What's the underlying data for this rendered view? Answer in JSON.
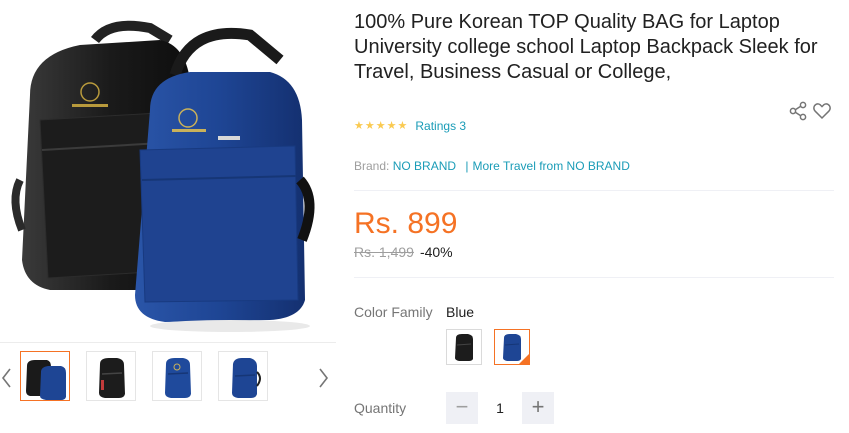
{
  "product": {
    "title": "100% Pure Korean TOP Quality BAG for Laptop University college school Laptop Backpack Sleek for Travel, Business Casual or College,",
    "rating_stars": 5,
    "ratings_text": "Ratings 3",
    "brand_label": "Brand:",
    "brand_name": "NO BRAND",
    "more_from": "More Travel from NO BRAND",
    "price": "Rs. 899",
    "original_price": "Rs. 1,499",
    "discount": "-40%"
  },
  "gallery": {
    "thumbnails": [
      {
        "name": "black-and-blue-backpacks",
        "active": true
      },
      {
        "name": "black-backpack",
        "active": false
      },
      {
        "name": "blue-backpack-front",
        "active": false
      },
      {
        "name": "blue-backpack-angle",
        "active": false
      }
    ],
    "prev_icon": "chevron-left-icon",
    "next_icon": "chevron-right-icon"
  },
  "color_family": {
    "label": "Color Family",
    "selected": "Blue",
    "options": [
      "Black",
      "Blue"
    ]
  },
  "quantity": {
    "label": "Quantity",
    "value": "1",
    "minus": "−",
    "plus": "+"
  },
  "icons": {
    "share": "share-icon",
    "wishlist": "heart-icon",
    "star": "★"
  },
  "colors": {
    "accent": "#f57224",
    "link": "#1a9cb7",
    "star": "#faca51"
  }
}
